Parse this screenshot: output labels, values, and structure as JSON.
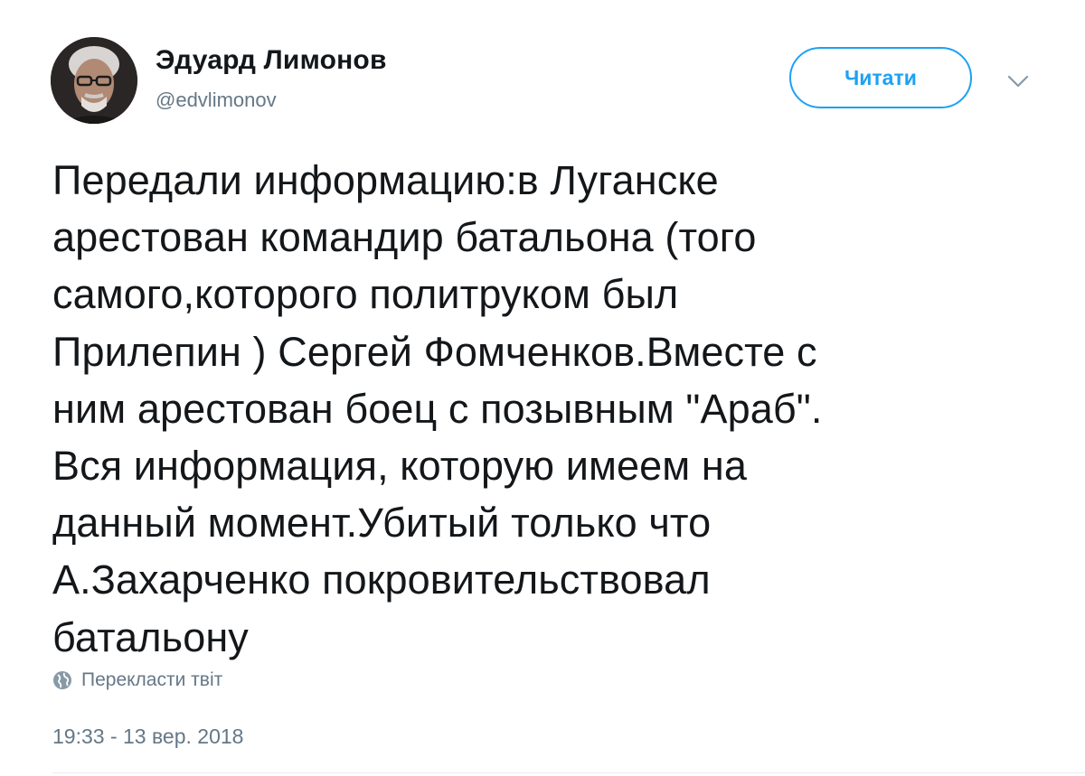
{
  "author": {
    "display_name": "Эдуард Лимонов",
    "handle": "@edvlimonov",
    "avatar_icon": "user-photo-avatar"
  },
  "actions": {
    "follow_label": "Читати",
    "menu_icon": "chevron-down-icon"
  },
  "tweet": {
    "text": "Передали информацию:в Луганске\nарестован  командир батальона (того\nсамого,которого политруком был\nПрилепин ) Сергей Фомченков.Вместе с\nним арестован боец с позывным \"Араб\".\nВся информация, которую имеем на\nданный момент.Убитый только что\nА.Захарченко покровительствовал\nбатальону",
    "translate_label": "Перекласти твіт",
    "translate_icon": "globe-icon",
    "timestamp": "19:33 - 13 вер. 2018"
  },
  "colors": {
    "accent": "#1da1f2",
    "text_primary": "#14171a",
    "text_secondary": "#657786",
    "divider": "#e6ecf0"
  }
}
